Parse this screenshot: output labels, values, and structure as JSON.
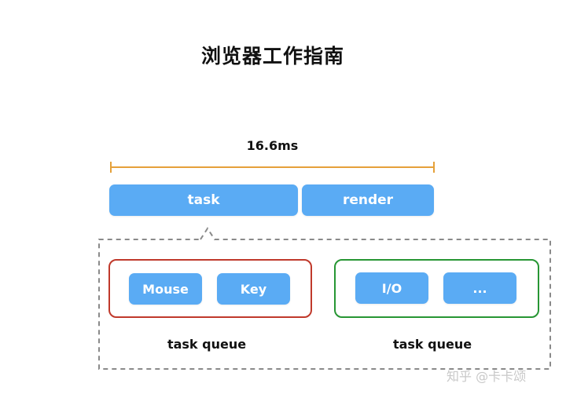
{
  "title": "浏览器工作指南",
  "frame": {
    "duration_label": "16.6ms"
  },
  "frame_parts": {
    "task_label": "task",
    "render_label": "render"
  },
  "queues": {
    "red": {
      "items": [
        "Mouse",
        "Key"
      ],
      "label": "task queue"
    },
    "green": {
      "items": [
        "I/O",
        "..."
      ],
      "label": "task queue"
    }
  },
  "watermark": "知乎 @卡卡颂",
  "colors": {
    "pill_blue": "#5aabf4",
    "bracket_orange": "#e5a13a",
    "queue_red": "#c0392b",
    "queue_green": "#279634",
    "dashed_gray": "#8a8a8a"
  }
}
